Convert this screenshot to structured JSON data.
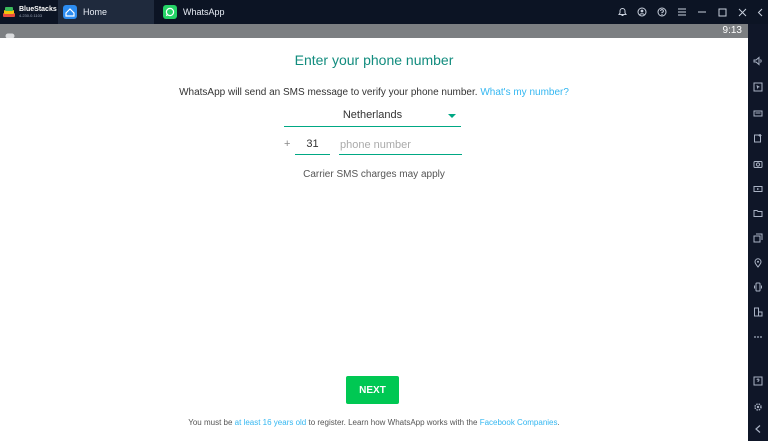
{
  "titlebar": {
    "brand": {
      "name": "BlueStacks",
      "version": "4.230.0.1103"
    },
    "tabs": [
      {
        "label": "Home",
        "icon": "home-icon"
      },
      {
        "label": "WhatsApp",
        "icon": "whatsapp-icon"
      }
    ]
  },
  "statusbar": {
    "time": "9:13"
  },
  "screen": {
    "title": "Enter your phone number",
    "description": "WhatsApp will send an SMS message to verify your phone number.",
    "description_link": "What's my number?",
    "country": "Netherlands",
    "plus": "+",
    "country_code": "31",
    "phone_placeholder": "phone number",
    "phone_value": "",
    "carrier_note": "Carrier SMS charges may apply",
    "next_label": "NEXT",
    "footer": {
      "prefix": "You must be ",
      "age_link": "at least 16 years old",
      "middle": " to register. Learn how WhatsApp works with the ",
      "companies_link": "Facebook Companies",
      "suffix": "."
    }
  },
  "colors": {
    "accent": "#128c7e",
    "underline": "#00a884",
    "link": "#34b7f1",
    "button": "#00c853",
    "titlebar": "#0c1424"
  }
}
